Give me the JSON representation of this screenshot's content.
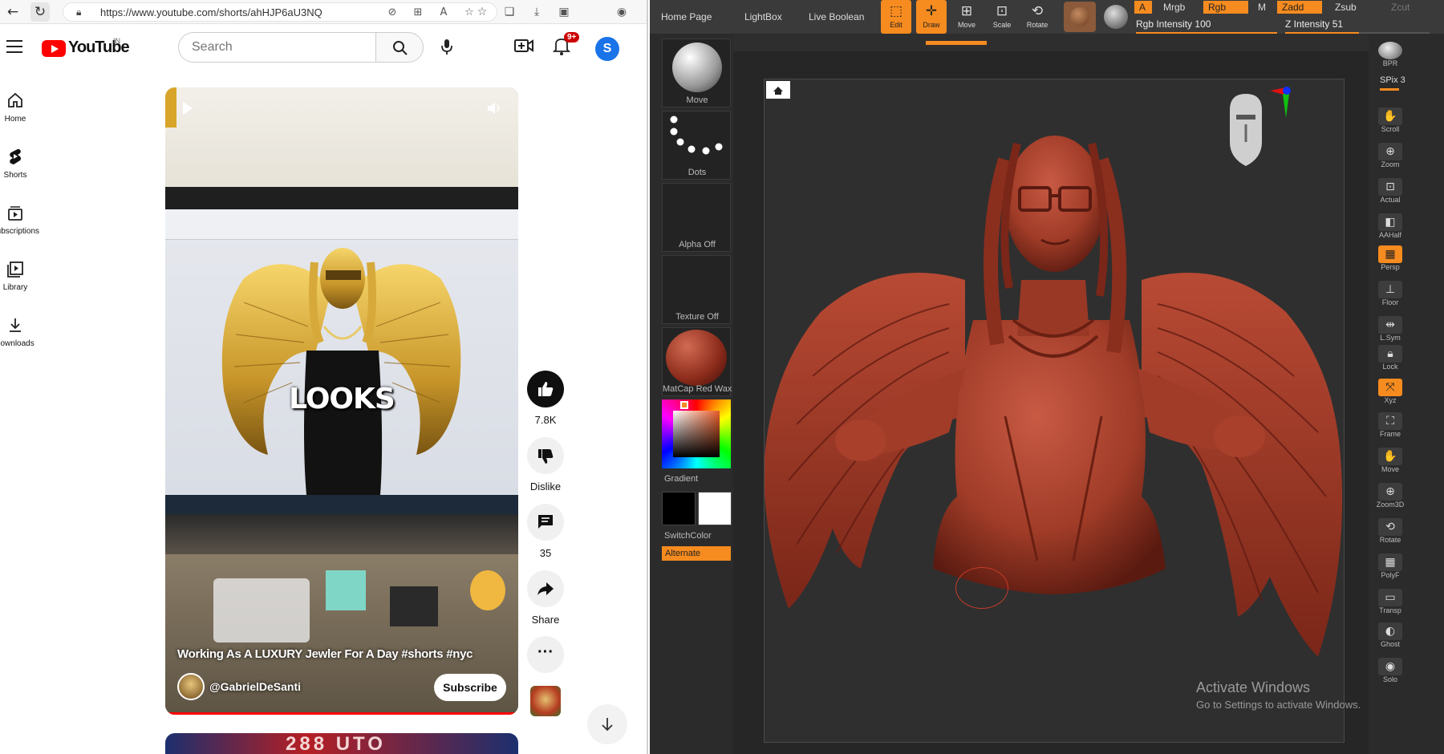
{
  "browser": {
    "url": "https://www.youtube.com/shorts/ahHJP6aU3NQ",
    "back_icon": "back-arrow-icon",
    "reload_icon": "reload-icon"
  },
  "youtube": {
    "logo_text": "YouTube",
    "region": "IN",
    "search_placeholder": "Search",
    "notification_badge": "9+",
    "avatar_letter": "S",
    "sidebar": [
      {
        "label": "Home",
        "icon": "home-icon"
      },
      {
        "label": "Shorts",
        "icon": "shorts-icon"
      },
      {
        "label": "Subscriptions",
        "icon": "subscriptions-icon"
      },
      {
        "label": "Library",
        "icon": "library-icon"
      },
      {
        "label": "Downloads",
        "icon": "download-icon"
      }
    ],
    "short": {
      "overlay_caption": "LOOKS",
      "title": "Working As A LUXURY Jewler For A Day #shorts #nyc",
      "channel": "@GabrielDeSanti",
      "subscribe_label": "Subscribe"
    },
    "actions": {
      "like_count": "7.8K",
      "dislike_label": "Dislike",
      "comment_count": "35",
      "share_label": "Share"
    },
    "next_thumb_text": "288 UTO"
  },
  "zbrush": {
    "top_buttons": [
      "Home Page",
      "LightBox",
      "Live Boolean"
    ],
    "tools": [
      {
        "label": "Edit",
        "active": true
      },
      {
        "label": "Draw",
        "active": true
      },
      {
        "label": "Move",
        "active": false
      },
      {
        "label": "Scale",
        "active": false
      },
      {
        "label": "Rotate",
        "active": false
      }
    ],
    "chips": {
      "a": "A",
      "mrgb": "Mrgb",
      "rgb": "Rgb",
      "m": "M",
      "zadd": "Zadd",
      "zsub": "Zsub",
      "zcut": "Zcut"
    },
    "rgb_intensity_label": "Rgb Intensity",
    "rgb_intensity_value": "100",
    "rgb_intensity_fraction": 1.0,
    "z_intensity_label": "Z Intensity",
    "z_intensity_value": "51",
    "z_intensity_fraction": 0.51,
    "left_panel": {
      "brush": "Move",
      "stroke": "Dots",
      "alpha": "Alpha Off",
      "texture": "Texture Off",
      "material": "MatCap Red Wax",
      "gradient_label": "Gradient",
      "switch_color_label": "SwitchColor",
      "alternate_label": "Alternate"
    },
    "right_panel": [
      {
        "label": "BPR",
        "active": false
      },
      {
        "label": "Scroll",
        "active": false
      },
      {
        "label": "Zoom",
        "active": false
      },
      {
        "label": "Actual",
        "active": false
      },
      {
        "label": "AAHalf",
        "active": false
      },
      {
        "label": "Persp",
        "active": true
      },
      {
        "label": "Floor",
        "active": false
      },
      {
        "label": "L.Sym",
        "active": false
      },
      {
        "label": "Lock",
        "active": false
      },
      {
        "label": "Xyz",
        "active": true
      },
      {
        "label": "Frame",
        "active": false
      },
      {
        "label": "Move",
        "active": false
      },
      {
        "label": "Zoom3D",
        "active": false
      },
      {
        "label": "Rotate",
        "active": false
      },
      {
        "label": "PolyF",
        "active": false
      },
      {
        "label": "Transp",
        "active": false
      },
      {
        "label": "Ghost",
        "active": false
      },
      {
        "label": "Solo",
        "active": false
      }
    ],
    "spix_label": "SPix 3",
    "sculpt_color": "#a8402c",
    "accent_color": "#f68b1f"
  },
  "watermark": {
    "title": "Activate Windows",
    "subtitle": "Go to Settings to activate Windows."
  }
}
